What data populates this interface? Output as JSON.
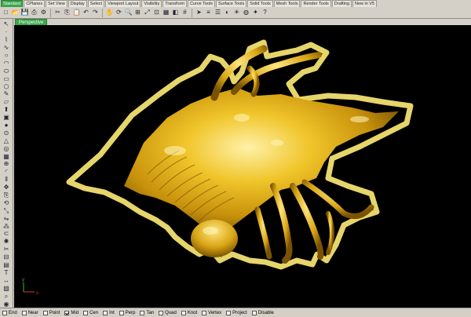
{
  "tabs": [
    "Standard",
    "CPlanes",
    "Set View",
    "Display",
    "Select",
    "Viewport Layout",
    "Visibility",
    "Transform",
    "Curve Tools",
    "Surface Tools",
    "Solid Tools",
    "Mesh Tools",
    "Render Tools",
    "Drafting",
    "New in V5"
  ],
  "active_tab_index": 0,
  "viewport": {
    "title": "Perspective"
  },
  "axes": {
    "x": "x",
    "y": "y"
  },
  "snaps": [
    {
      "label": "End",
      "checked": false
    },
    {
      "label": "Near",
      "checked": false
    },
    {
      "label": "Point",
      "checked": false
    },
    {
      "label": "Mid",
      "checked": true
    },
    {
      "label": "Cen",
      "checked": false
    },
    {
      "label": "Int",
      "checked": false
    },
    {
      "label": "Perp",
      "checked": false
    },
    {
      "label": "Tan",
      "checked": false
    },
    {
      "label": "Quad",
      "checked": false
    },
    {
      "label": "Knot",
      "checked": false
    },
    {
      "label": "Vertex",
      "checked": false
    },
    {
      "label": "Project",
      "checked": false
    },
    {
      "label": "Disable",
      "checked": false
    }
  ],
  "toolbar_icons": [
    "new-file-icon",
    "open-icon",
    "save-icon",
    "print-icon",
    "properties-icon",
    "cut-icon",
    "copy-icon",
    "paste-icon",
    "undo-icon",
    "redo-icon",
    "pan-icon",
    "rotate-view-icon",
    "zoom-icon",
    "zoom-window-icon",
    "zoom-extents-icon",
    "zoom-selected-icon",
    "four-views-icon",
    "set-cplane-icon",
    "grid-icon",
    "select-icon",
    "layer-icon",
    "object-properties-icon",
    "shade-icon",
    "render-icon",
    "material-icon",
    "light-icon",
    "help-icon"
  ],
  "left_icons": [
    "select-arrow-icon",
    "point-icon",
    "polyline-icon",
    "curve-icon",
    "circle-icon",
    "arc-icon",
    "ellipse-icon",
    "rectangle-icon",
    "polygon-icon",
    "freeform-icon",
    "surface-icon",
    "extrude-icon",
    "box-icon",
    "sphere-icon",
    "cylinder-icon",
    "cone-icon",
    "torus-icon",
    "mesh-icon",
    "boolean-icon",
    "fillet-icon",
    "offset-icon",
    "move-icon",
    "copy-tool-icon",
    "rotate-icon",
    "scale-icon",
    "mirror-icon",
    "array-icon",
    "join-icon",
    "explode-icon",
    "trim-icon",
    "split-icon",
    "group-icon",
    "text-icon",
    "dimension-icon",
    "hatch-icon",
    "analyze-icon",
    "render-tool-icon"
  ],
  "colors": {
    "accent": "#3aa64b",
    "model_gold": "#e6b412",
    "selection_outline": "#f2e070"
  }
}
